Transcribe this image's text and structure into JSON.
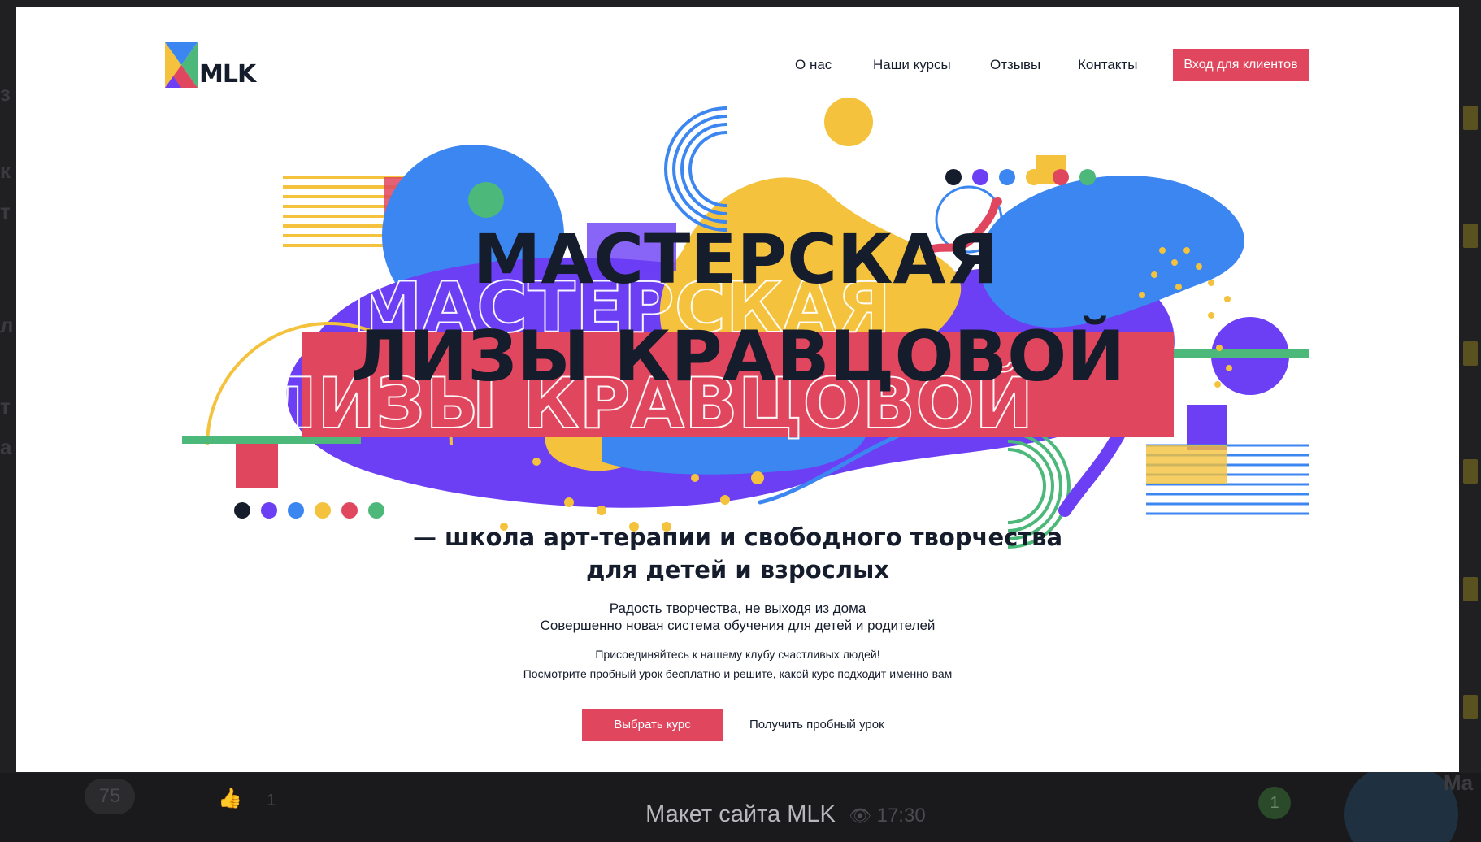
{
  "site": {
    "logo_text": "MLK",
    "nav": [
      {
        "label": "О нас"
      },
      {
        "label": "Наши курсы"
      },
      {
        "label": "Отзывы"
      },
      {
        "label": "Контакты"
      }
    ],
    "login_button": "Вход для клиентов"
  },
  "hero": {
    "title_line1": "МАСТЕРСКАЯ",
    "title_line2": "ЛИЗЫ КРАВЦОВОЙ",
    "tagline_line1": "— школа арт-терапии и свободного творчества",
    "tagline_line2": "для детей и взрослых",
    "sub_line1": "Радость творчества, не выходя из дома",
    "sub_line2": "Совершенно новая система обучения для детей и родителей",
    "small_line1": "Присоединяйтесь к нашему клубу счастливых людей!",
    "small_line2": "Посмотрите пробный урок бесплатно и решите, какой курс подходит именно вам",
    "primary_button": "Выбрать курс",
    "secondary_link": "Получить пробный урок"
  },
  "viewer": {
    "caption": "Макет сайта MLK",
    "time": "17:30",
    "badge_count": "75",
    "like_count": "1",
    "unread_count": "1"
  },
  "colors": {
    "accent_red": "#e0475e",
    "navy": "#151c2c",
    "blue": "#3b86f0",
    "purple": "#6c3ff5",
    "yellow": "#f4c23c",
    "green": "#4cb87a"
  },
  "icons": [
    "eye-icon",
    "thumbs-up-icon",
    "mlk-logo-icon"
  ]
}
